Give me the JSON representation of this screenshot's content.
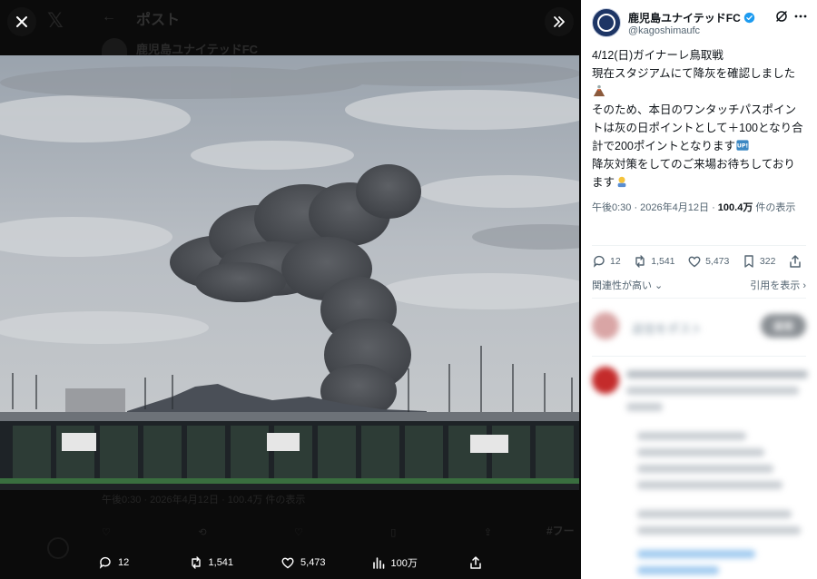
{
  "background": {
    "header_title": "ポスト",
    "account_name": "鹿児島ユナイテッドFC",
    "timestamp": "午後0:30 · 2026年4月12日 · 100.4万 件の表示",
    "hashtag": "#フー"
  },
  "viewer": {
    "close_label": "close",
    "expand_label": "expand",
    "stats": {
      "replies": "12",
      "reposts": "1,541",
      "likes": "5,473",
      "views": "100万"
    }
  },
  "post": {
    "display_name": "鹿児島ユナイテッドFC",
    "handle": "@kagoshimaufc",
    "text_lines": [
      "4/12(日)ガイナーレ鳥取戦",
      "現在スタジアムにて降灰を確認しました",
      "そのため、本日のワンタッチパスポイントは灰の日ポイントとして＋100となり合計で200ポイントとなります",
      "降灰対策をしてのご来場お待ちしております"
    ],
    "time": "午後0:30 · 2026年4月12日 · ",
    "views_count": "100.4万",
    "views_suffix": " 件の表示",
    "actions": {
      "replies": "12",
      "reposts": "1,541",
      "likes": "5,473",
      "bookmarks": "322"
    },
    "relevance_label": "関連性が高い",
    "quotes_label": "引用を表示",
    "reply_placeholder": "返信をポスト",
    "reply_button": "返信"
  },
  "colors": {
    "accent": "#1d9bf0",
    "panel_bg": "#ffffff",
    "viewer_bg": "#0b0b0b",
    "text_secondary": "#536471"
  },
  "icons": [
    "close-icon",
    "x-logo-icon",
    "expand-icon",
    "reply-icon",
    "repost-icon",
    "like-icon",
    "views-icon",
    "share-icon",
    "bookmark-icon",
    "verified-icon",
    "grok-icon",
    "more-icon"
  ]
}
